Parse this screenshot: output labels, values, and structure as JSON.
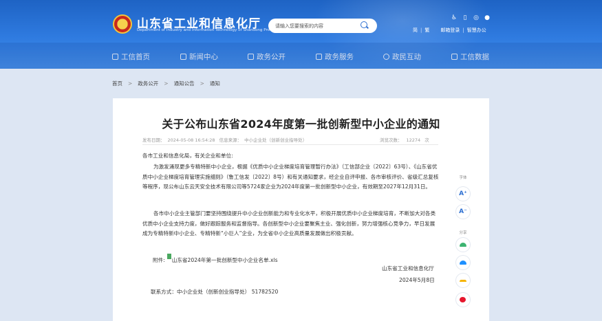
{
  "header": {
    "site_title": "山东省工业和信息化厅",
    "site_subtitle": "Department of Industry and Information Technology of Shandong Province",
    "search_placeholder": "请输入您要搜索的内容",
    "lang_simplified": "简",
    "lang_traditional": "繁",
    "mail_login": "邮箱登录",
    "smart_office": "智慧办公"
  },
  "nav": {
    "items": [
      {
        "label": "工信首页",
        "icon": "home-icon"
      },
      {
        "label": "新闻中心",
        "icon": "news-icon"
      },
      {
        "label": "政务公开",
        "icon": "disclosure-icon"
      },
      {
        "label": "政务服务",
        "icon": "service-icon"
      },
      {
        "label": "政民互动",
        "icon": "interaction-icon"
      },
      {
        "label": "工信数据",
        "icon": "data-icon"
      }
    ]
  },
  "breadcrumb": [
    "首页",
    "政务公开",
    "通知公告",
    "通知"
  ],
  "breadcrumb_sep": ">",
  "article": {
    "title": "关于公布山东省2024年度第一批创新型中小企业的通知",
    "publish_label": "发布日期：",
    "publish_date": "2024-05-08 16:54:28",
    "source_label": "信息来源：",
    "source": "中小企业处（创新创业指导处）",
    "views_label": "浏览次数：",
    "views": "12274",
    "views_unit": "次",
    "salutation": "各市工业和信息化局，有关企业和单位:",
    "para1": "为激发涌现更多专精特新中小企业，根据《优质中小企业梯度培育管理暂行办法》（工信部企业〔2022〕63号）、《山东省优质中小企业梯度培育管理实施细则》（鲁工信发〔2022〕8号）和有关通知要求，经企业自评申报、各市审核评价、省级汇总复核等程序，现公布山东云天安全技术有限公司等5724家企业为2024年度第一批创新型中小企业，有效期至2027年12月31日。",
    "para2": "各市中小企业主管部门要坚持围绕提升中小企业创新能力和专业化水平，积极开展优质中小企业梯度培育，不断加大对各类优质中小企业支持力度，做好跟踪服务和监督指导。各创新型中小企业要聚焦主业、强化创新，努力增强核心竞争力，早日发展成为专精特新中小企业、专精特新“小巨人”企业，为全省中小企业高质量发展做出积极贡献。",
    "attachment_label": "附件:",
    "attachment_file": "山东省2024年第一批创新型中小企业名单.xls",
    "sign_org": "山东省工业和信息化厅",
    "sign_date": "2024年5月8日",
    "contact": "联系方式：中小企业处（创新创业指导处） 51782520"
  },
  "side": {
    "font_label": "字体",
    "font_increase": "A⁺",
    "font_decrease": "A⁻",
    "share_label": "分享"
  },
  "colors": {
    "header_blue": "#2f7be0",
    "accent_blue": "#2e70d2",
    "wechat_green": "#3cb371",
    "qzone_blue": "#1e90ff",
    "qq_yellow": "#f5b400",
    "weibo_red": "#e6162d"
  }
}
